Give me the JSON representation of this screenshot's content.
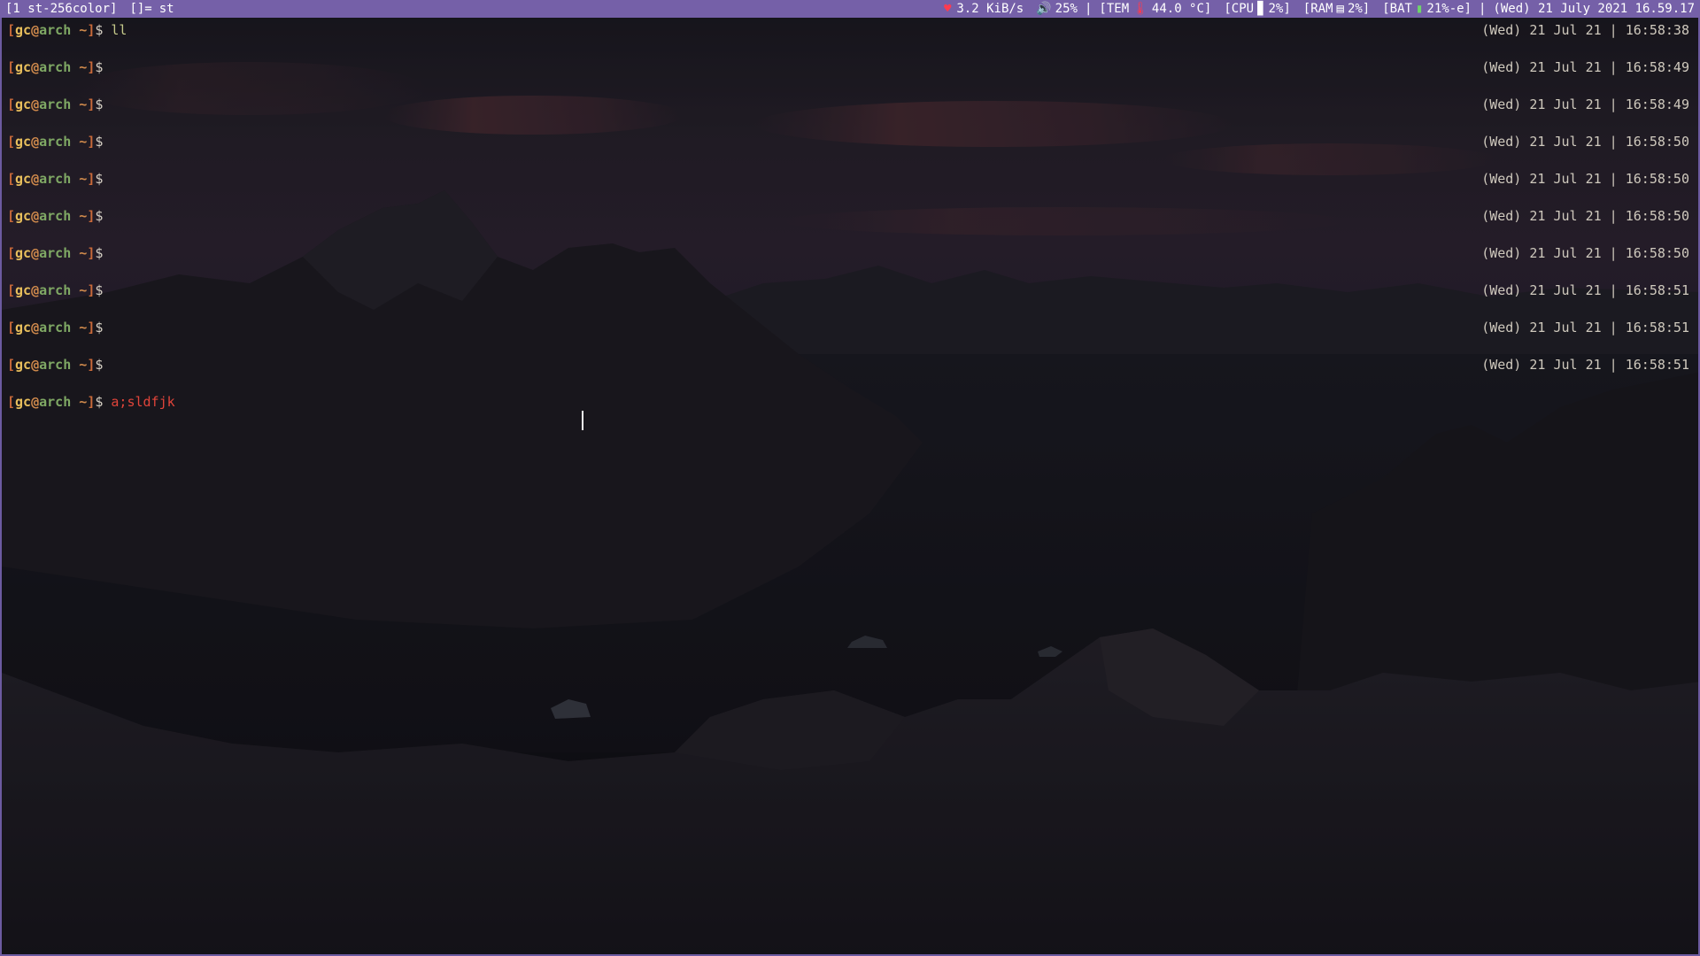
{
  "statusbar": {
    "tag": "[1 st-256color]",
    "layout": "[]=",
    "window_title": "st",
    "net": "3.2 KiB/s",
    "volume": "25%",
    "sep1": "|",
    "temp_label": "[TEM",
    "temp_value": "44.0 °C]",
    "cpu_label": "[CPU",
    "cpu_value": "2%]",
    "ram_label": "[RAM",
    "ram_value": "2%]",
    "bat_label": "[BAT",
    "bat_value": "21%-e]",
    "sep2": "|",
    "datetime": "(Wed) 21 July 2021 16.59.17",
    "icons": {
      "net": "heart-icon",
      "volume": "speaker-icon",
      "temp": "thermometer-icon",
      "cpu": "cpu-icon",
      "ram": "ram-icon",
      "battery": "battery-icon"
    },
    "colors": {
      "bar_bg": "#7560a8",
      "alert": "#ff3b4f",
      "battery": "#6fd46a"
    }
  },
  "terminal": {
    "prompt": {
      "open": "[",
      "user": "gc",
      "at": "@",
      "host": "arch",
      "dir": " ~",
      "close": "]",
      "dollar": "$"
    },
    "lines": [
      {
        "cmd": "ll",
        "ts": "(Wed) 21 Jul 21 | 16:58:38"
      },
      {
        "cmd": "",
        "ts": "(Wed) 21 Jul 21 | 16:58:49"
      },
      {
        "cmd": "",
        "ts": "(Wed) 21 Jul 21 | 16:58:49"
      },
      {
        "cmd": "",
        "ts": "(Wed) 21 Jul 21 | 16:58:50"
      },
      {
        "cmd": "",
        "ts": "(Wed) 21 Jul 21 | 16:58:50"
      },
      {
        "cmd": "",
        "ts": "(Wed) 21 Jul 21 | 16:58:50"
      },
      {
        "cmd": "",
        "ts": "(Wed) 21 Jul 21 | 16:58:50"
      },
      {
        "cmd": "",
        "ts": "(Wed) 21 Jul 21 | 16:58:51"
      },
      {
        "cmd": "",
        "ts": "(Wed) 21 Jul 21 | 16:58:51"
      },
      {
        "cmd": "",
        "ts": "(Wed) 21 Jul 21 | 16:58:51"
      }
    ],
    "current_input": "a;sldfjk",
    "colors": {
      "error_input": "#e0443a",
      "valid_input": "#c5c98a"
    }
  }
}
